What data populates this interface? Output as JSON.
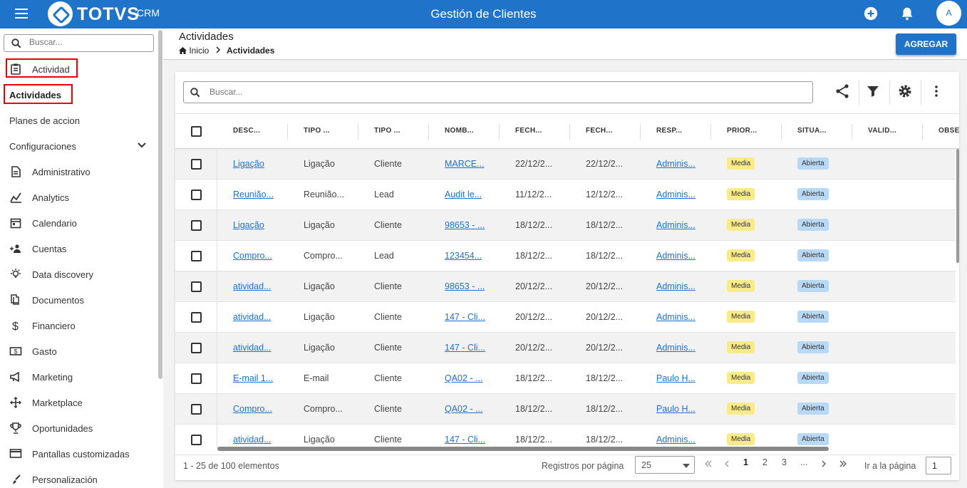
{
  "topbar": {
    "brand": "TOTVS",
    "brand_sub": "CRM",
    "title": "Gestión de Clientes",
    "avatar_initial": "A"
  },
  "sidebar": {
    "search_placeholder": "Buscar...",
    "items": [
      {
        "label": "Actividad",
        "icon": "clipboard-icon"
      },
      {
        "label": "Actividades"
      },
      {
        "label": "Planes de accion"
      },
      {
        "label": "Configuraciones",
        "icon": "chevron-down-icon"
      },
      {
        "label": "Administrativo",
        "icon": "document-icon"
      },
      {
        "label": "Analytics",
        "icon": "chart-icon"
      },
      {
        "label": "Calendario",
        "icon": "calendar-icon"
      },
      {
        "label": "Cuentas",
        "icon": "add-user-icon"
      },
      {
        "label": "Data discovery",
        "icon": "lightbulb-icon"
      },
      {
        "label": "Documentos",
        "icon": "documents-icon"
      },
      {
        "label": "Financiero",
        "icon": "dollar-icon"
      },
      {
        "label": "Gasto",
        "icon": "money-icon"
      },
      {
        "label": "Marketing",
        "icon": "megaphone-icon"
      },
      {
        "label": "Marketplace",
        "icon": "marketplace-icon"
      },
      {
        "label": "Oportunidades",
        "icon": "trophy-icon"
      },
      {
        "label": "Pantallas customizadas",
        "icon": "screen-icon"
      },
      {
        "label": "Personalización",
        "icon": "personalization-icon"
      }
    ]
  },
  "header": {
    "title": "Actividades",
    "breadcrumb_home": "Inicio",
    "breadcrumb_current": "Actividades",
    "add_button": "AGREGAR"
  },
  "grid": {
    "search_placeholder": "Buscar...",
    "columns": [
      "DESC...",
      "TIPO ...",
      "TIPO ...",
      "NOMB...",
      "FECH...",
      "FECH...",
      "RESP...",
      "PRIOR...",
      "SITUA...",
      "VALID...",
      "OBSE..."
    ],
    "rows": [
      [
        "Ligação",
        "Ligação",
        "Cliente",
        "MARCE...",
        "22/12/2...",
        "22/12/2...",
        "Adminis...",
        "Media",
        "Abierta"
      ],
      [
        "Reunião...",
        "Reunião...",
        "Lead",
        "Audit le...",
        "11/12/2...",
        "12/12/2...",
        "Adminis...",
        "Media",
        "Abierta"
      ],
      [
        "Ligação",
        "Ligação",
        "Cliente",
        "98653 - ...",
        "18/12/2...",
        "18/12/2...",
        "Adminis...",
        "Media",
        "Abierta"
      ],
      [
        "Compro...",
        "Compro...",
        "Lead",
        "123454...",
        "18/12/2...",
        "18/12/2...",
        "Adminis...",
        "Media",
        "Abierta"
      ],
      [
        "atividad...",
        "Ligação",
        "Cliente",
        "98653 - ...",
        "20/12/2...",
        "20/12/2...",
        "Adminis...",
        "Media",
        "Abierta"
      ],
      [
        "atividad...",
        "Ligação",
        "Cliente",
        "147 - Cli...",
        "20/12/2...",
        "20/12/2...",
        "Adminis...",
        "Media",
        "Abierta"
      ],
      [
        "atividad...",
        "Ligação",
        "Cliente",
        "147 - Cli...",
        "20/12/2...",
        "20/12/2...",
        "Adminis...",
        "Media",
        "Abierta"
      ],
      [
        "E-mail 1...",
        "E-mail",
        "Cliente",
        "QA02 - ...",
        "18/12/2...",
        "18/12/2...",
        "Paulo H...",
        "Media",
        "Abierta"
      ],
      [
        "Compro...",
        "Compro...",
        "Cliente",
        "QA02 - ...",
        "18/12/2...",
        "18/12/2...",
        "Paulo H...",
        "Media",
        "Abierta"
      ],
      [
        "atividad...",
        "Ligação",
        "Cliente",
        "147 - Cli...",
        "18/12/2...",
        "18/12/2...",
        "Adminis...",
        "Media",
        "Abierta"
      ]
    ]
  },
  "footer": {
    "range_text": "1 - 25 de 100 elementos",
    "per_page_label": "Registros por página",
    "per_page_value": "25",
    "pages": [
      "1",
      "2",
      "3",
      "..."
    ],
    "goto_label": "Ir a la página",
    "goto_value": "1"
  },
  "colors": {
    "primary": "#1f73c9",
    "priority_tag": "#faeb8a",
    "status_tag": "#b8d9f5",
    "link": "#1f6fd0",
    "highlight": "#e00000"
  }
}
